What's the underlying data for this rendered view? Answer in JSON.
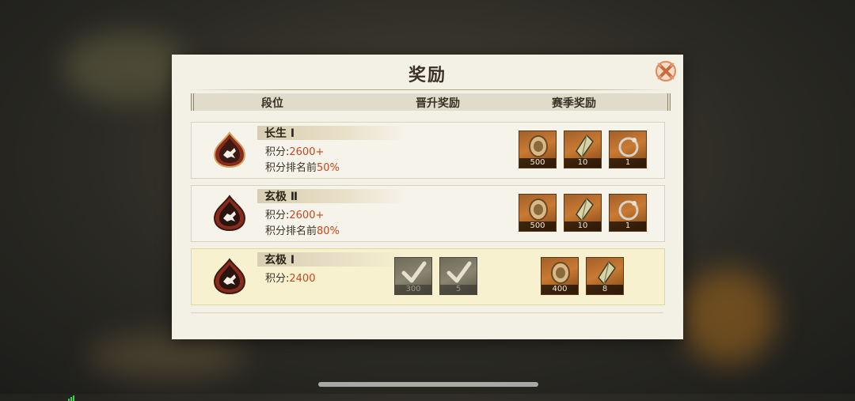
{
  "panel": {
    "title": "奖励",
    "headers": {
      "rank": "段位",
      "promotion": "晋升奖励",
      "season": "赛季奖励"
    }
  },
  "rows": [
    {
      "tier": "长生 Ⅰ",
      "score_label": "积分:",
      "score_value": "2600+",
      "rank_label": "积分排名前",
      "rank_value": "50%",
      "icon": "changsheng-tier-emblem-icon",
      "promotion_rewards": [],
      "season_rewards": [
        {
          "icon": "medal-coin-icon",
          "count": "500"
        },
        {
          "icon": "jade-crystal-icon",
          "count": "10"
        },
        {
          "icon": "silver-ring-icon",
          "count": "1"
        }
      ]
    },
    {
      "tier": "玄极 Ⅱ",
      "score_label": "积分:",
      "score_value": "2600+",
      "rank_label": "积分排名前",
      "rank_value": "80%",
      "icon": "xuanji-tier-emblem-icon",
      "promotion_rewards": [],
      "season_rewards": [
        {
          "icon": "medal-coin-icon",
          "count": "500"
        },
        {
          "icon": "jade-crystal-icon",
          "count": "10"
        },
        {
          "icon": "silver-ring-icon",
          "count": "1"
        }
      ]
    },
    {
      "tier": "玄极 Ⅰ",
      "score_label": "积分:",
      "score_value": "2400",
      "icon": "xuanji-tier-emblem-icon",
      "promotion_rewards": [
        {
          "icon": "claimed-check-icon",
          "count": "300"
        },
        {
          "icon": "claimed-check-icon",
          "count": "5"
        }
      ],
      "season_rewards": [
        {
          "icon": "medal-coin-icon",
          "count": "400"
        },
        {
          "icon": "jade-crystal-icon",
          "count": "8"
        }
      ]
    }
  ],
  "colors": {
    "highlight": "#c8481c",
    "panel": "#f3f0e6",
    "active_row": "#f7f1cf"
  }
}
